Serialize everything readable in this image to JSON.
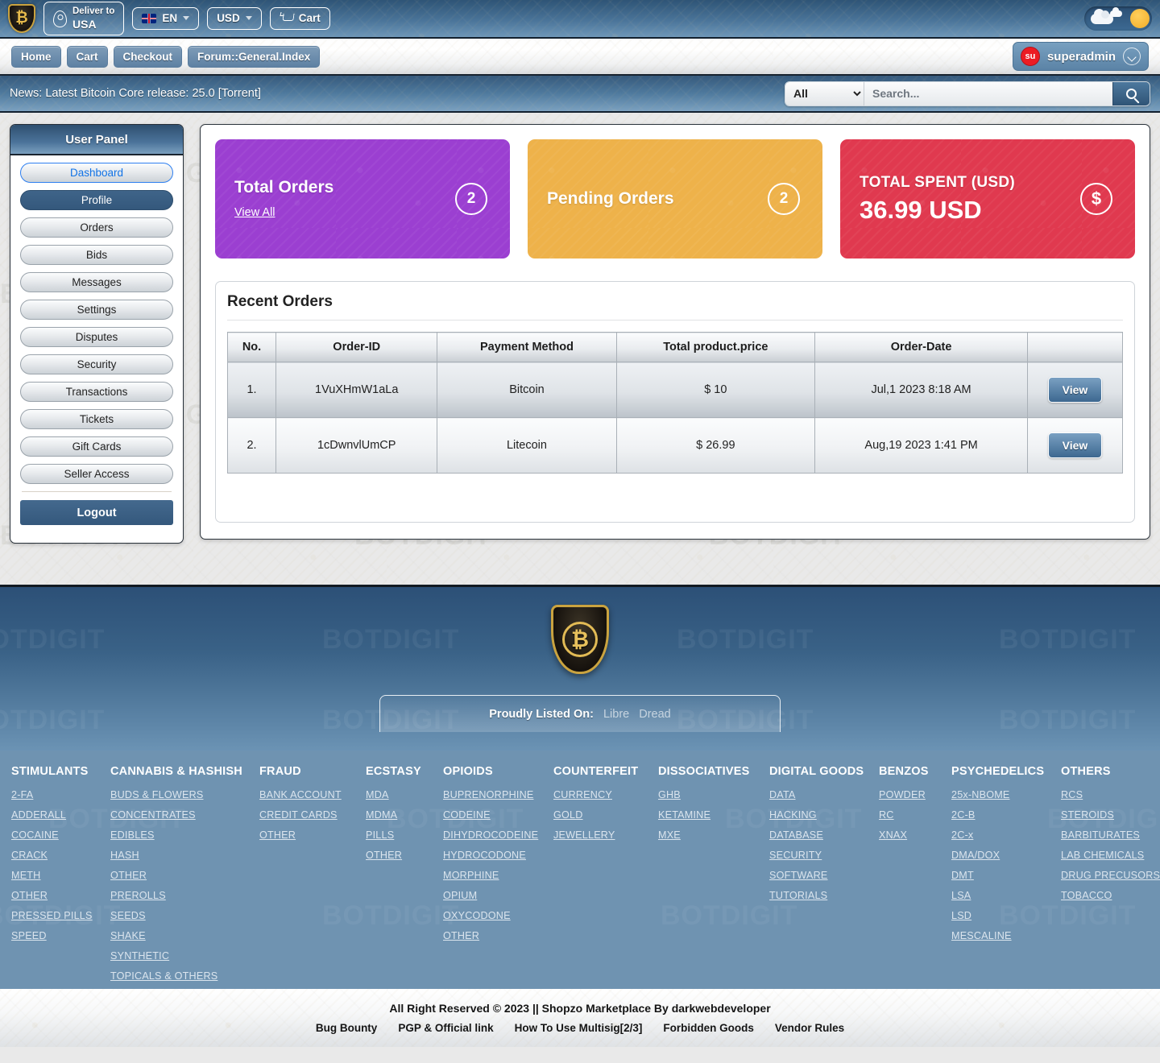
{
  "topbar": {
    "logo_icon": "bitcoin-shield-logo",
    "deliver_label": "Deliver to",
    "deliver_value": "USA",
    "language": "EN",
    "currency": "USD",
    "cart_label": "Cart",
    "weather_toggle_icon": "sun-cloud-toggle"
  },
  "nav": {
    "items": [
      {
        "label": "Home"
      },
      {
        "label": "Cart"
      },
      {
        "label": "Checkout"
      },
      {
        "label": "Forum::General.Index"
      }
    ],
    "user": {
      "avatar_initials": "su",
      "name": "superadmin"
    }
  },
  "news": {
    "text": "News: Latest Bitcoin Core release: 25.0 [Torrent]"
  },
  "search": {
    "category_selected": "All",
    "placeholder": "Search...",
    "value": "",
    "icon": "search-icon"
  },
  "sidebar": {
    "title": "User Panel",
    "items": [
      {
        "label": "Dashboard",
        "state": "active"
      },
      {
        "label": "Profile",
        "state": "selected"
      },
      {
        "label": "Orders",
        "state": ""
      },
      {
        "label": "Bids",
        "state": ""
      },
      {
        "label": "Messages",
        "state": ""
      },
      {
        "label": "Settings",
        "state": ""
      },
      {
        "label": "Disputes",
        "state": ""
      },
      {
        "label": "Security",
        "state": ""
      },
      {
        "label": "Transactions",
        "state": ""
      },
      {
        "label": "Tickets",
        "state": ""
      },
      {
        "label": "Gift Cards",
        "state": ""
      },
      {
        "label": "Seller Access",
        "state": ""
      }
    ],
    "logout_label": "Logout"
  },
  "cards": {
    "total_orders": {
      "title": "Total Orders",
      "count": "2",
      "link": "View All",
      "color": "#9b3fd1"
    },
    "pending_orders": {
      "title": "Pending Orders",
      "count": "2",
      "color": "#eeb24a"
    },
    "total_spent": {
      "title": "TOTAL SPENT (USD)",
      "amount": "36.99 USD",
      "icon": "dollar-icon",
      "color": "#e0394f"
    }
  },
  "recent_orders": {
    "title": "Recent Orders",
    "columns": [
      "No.",
      "Order-ID",
      "Payment Method",
      "Total product.price",
      "Order-Date",
      ""
    ],
    "rows": [
      {
        "no": "1.",
        "order_id": "1VuXHmW1aLa",
        "payment": "Bitcoin",
        "price": "$ 10",
        "date": "Jul,1 2023 8:18 AM",
        "action": "View"
      },
      {
        "no": "2.",
        "order_id": "1cDwnvlUmCP",
        "payment": "Litecoin",
        "price": "$ 26.99",
        "date": "Aug,19 2023 1:41 PM",
        "action": "View"
      }
    ]
  },
  "footer": {
    "logo_icon": "bitcoin-shield-logo",
    "listed_label": "Proudly Listed On:",
    "listed_links": [
      {
        "label": "Libre"
      },
      {
        "label": "Dread"
      }
    ],
    "categories": [
      {
        "title": "STIMULANTS",
        "links": [
          "2-FA",
          "ADDERALL",
          "COCAINE",
          "CRACK",
          "METH",
          "OTHER",
          "PRESSED PILLS",
          "SPEED"
        ]
      },
      {
        "title": "CANNABIS & HASHISH",
        "links": [
          "BUDS & FLOWERS",
          "CONCENTRATES",
          "EDIBLES",
          "HASH",
          "OTHER",
          "PREROLLS",
          "SEEDS",
          "SHAKE",
          "SYNTHETIC",
          "TOPICALS & OTHERS"
        ]
      },
      {
        "title": "FRAUD",
        "links": [
          "BANK ACCOUNT",
          "CREDIT CARDS",
          "OTHER"
        ]
      },
      {
        "title": "ECSTASY",
        "links": [
          "MDA",
          "MDMA",
          "PILLS",
          "OTHER"
        ]
      },
      {
        "title": "OPIOIDS",
        "links": [
          "BUPRENORPHINE",
          "CODEINE",
          "DIHYDROCODEINE",
          "HYDROCODONE",
          "MORPHINE",
          "OPIUM",
          "OXYCODONE",
          "OTHER"
        ]
      },
      {
        "title": "COUNTERFEIT",
        "links": [
          "CURRENCY",
          "GOLD",
          "JEWELLERY"
        ]
      },
      {
        "title": "DISSOCIATIVES",
        "links": [
          "GHB",
          "KETAMINE",
          "MXE"
        ]
      },
      {
        "title": "DIGITAL GOODS",
        "links": [
          "DATA",
          "HACKING",
          "DATABASE",
          "SECURITY",
          "SOFTWARE",
          "TUTORIALS"
        ]
      },
      {
        "title": "BENZOS",
        "links": [
          "POWDER",
          "RC",
          "XNAX"
        ]
      },
      {
        "title": "PSYCHEDELICS",
        "links": [
          "25x-NBOME",
          "2C-B",
          "2C-x",
          "DMA/DOX",
          "DMT",
          "LSA",
          "LSD",
          "MESCALINE"
        ]
      },
      {
        "title": "OTHERS",
        "links": [
          "RCS",
          "STEROIDS",
          "BARBITURATES",
          "LAB CHEMICALS",
          "DRUG PRECUSORS",
          "TOBACCO"
        ]
      }
    ],
    "copyright": "All Right Reserved © 2023 || Shopzo Marketplace By darkwebdeveloper",
    "bottom_links": [
      "Bug Bounty",
      "PGP & Official link",
      "How To Use Multisig[2/3]",
      "Forbidden Goods",
      "Vendor Rules"
    ]
  },
  "watermark_text": "BOTDIGIT"
}
